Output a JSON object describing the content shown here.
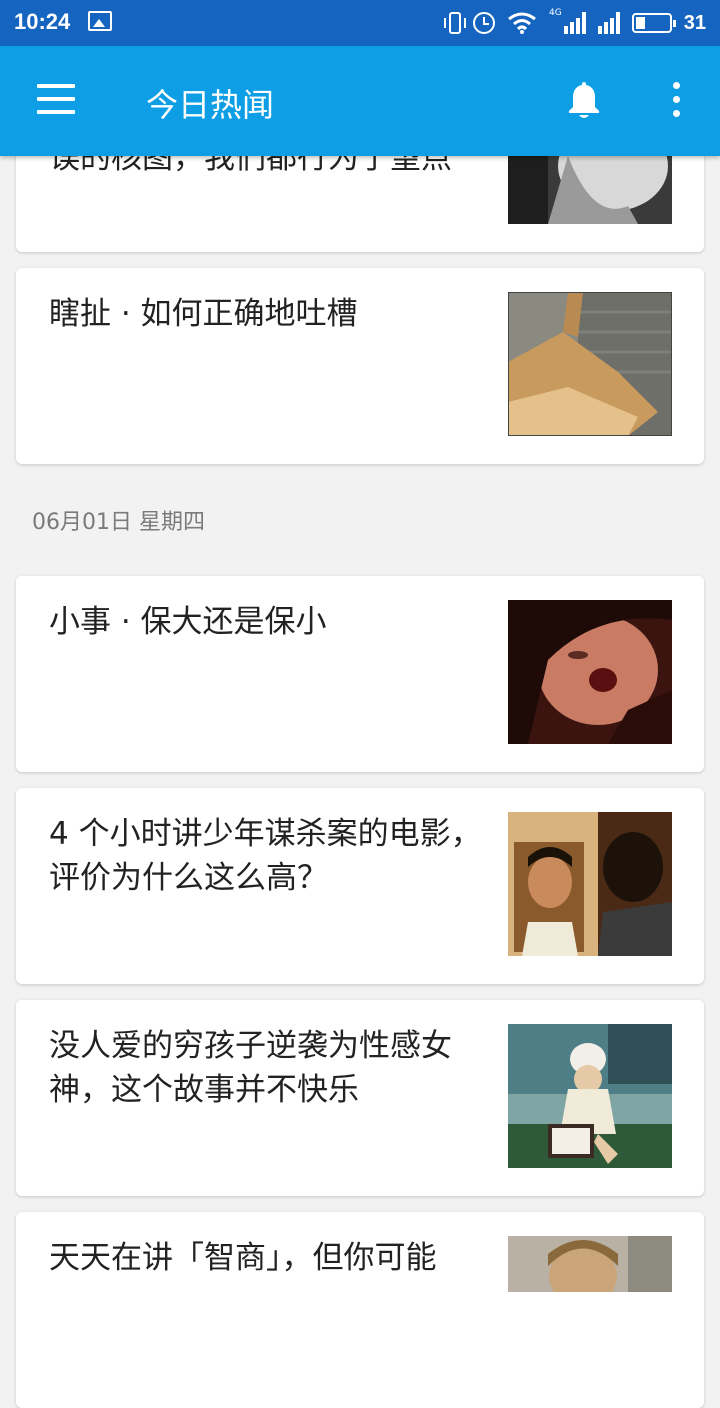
{
  "status_bar": {
    "time": "10:24",
    "battery_level": "31",
    "network": "4G",
    "color": "#1565c0"
  },
  "app_bar": {
    "title": "今日热闻",
    "color": "#0d9ee6",
    "icons": [
      "menu-icon",
      "notifications-bell-icon",
      "more-vert-icon"
    ]
  },
  "feed": {
    "top_partial_story": {
      "title": "误的核图，我们都行为了望点"
    },
    "stories_before": [
      {
        "title": "瞎扯 · 如何正确地吐槽"
      }
    ],
    "date_header": "06月01日 星期四",
    "stories": [
      {
        "title": "小事 · 保大还是保小"
      },
      {
        "title": "4 个小时讲少年谋杀案的电影，评价为什么这么高？"
      },
      {
        "title": "没人爱的穷孩子逆袭为性感女神，这个故事并不快乐"
      },
      {
        "title": "天天在讲「智商」，但你可能"
      }
    ]
  }
}
